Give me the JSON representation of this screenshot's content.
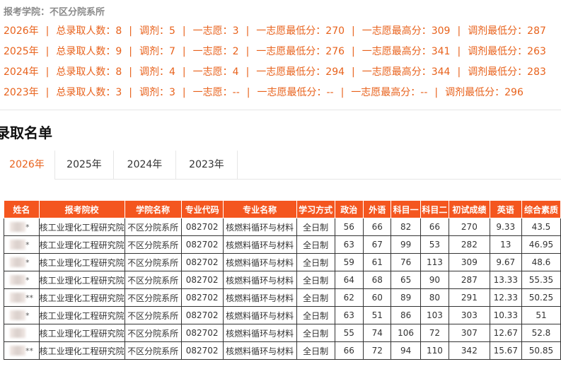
{
  "college": {
    "label": "报考学院：",
    "value": "不区分院系所"
  },
  "stats_separator": "|",
  "stats": [
    {
      "year": "2026年",
      "total": "总录取人数：8",
      "adjust": "调剂：5",
      "first_choice": "一志愿：3",
      "first_min": "一志愿最低分：270",
      "first_max": "一志愿最高分：309",
      "adjust_min": "调剂最低分：287"
    },
    {
      "year": "2025年",
      "total": "总录取人数：9",
      "adjust": "调剂：7",
      "first_choice": "一志愿：2",
      "first_min": "一志愿最低分：276",
      "first_max": "一志愿最高分：341",
      "adjust_min": "调剂最低分：263"
    },
    {
      "year": "2024年",
      "total": "总录取人数：8",
      "adjust": "调剂：4",
      "first_choice": "一志愿：4",
      "first_min": "一志愿最低分：294",
      "first_max": "一志愿最高分：344",
      "adjust_min": "调剂最低分：283"
    },
    {
      "year": "2023年",
      "total": "总录取人数：3",
      "adjust": "调剂：3",
      "first_choice": "一志愿：--",
      "first_min": "一志愿最低分：--",
      "first_max": "一志愿最高分：--",
      "adjust_min": "调剂最低分：296"
    }
  ],
  "section_title": "录取名单",
  "tabs": [
    {
      "label": "2026年",
      "active": true
    },
    {
      "label": "2025年",
      "active": false
    },
    {
      "label": "2024年",
      "active": false
    },
    {
      "label": "2023年",
      "active": false
    }
  ],
  "table": {
    "headers": [
      "姓名",
      "报考院校",
      "学院名称",
      "专业代码",
      "专业名称",
      "学习方式",
      "政治",
      "外语",
      "科目一",
      "科目二",
      "初试成绩",
      "英语",
      "综合素质"
    ],
    "rows": [
      [
        "*",
        "核工业理化工程研究院",
        "不区分院系所",
        "082702",
        "核燃料循环与材料",
        "全日制",
        "56",
        "66",
        "82",
        "66",
        "270",
        "9.33",
        "43.5"
      ],
      [
        "*",
        "核工业理化工程研究院",
        "不区分院系所",
        "082702",
        "核燃料循环与材料",
        "全日制",
        "63",
        "67",
        "99",
        "53",
        "282",
        "13",
        "46.95"
      ],
      [
        "*",
        "核工业理化工程研究院",
        "不区分院系所",
        "082702",
        "核燃料循环与材料",
        "全日制",
        "59",
        "61",
        "76",
        "113",
        "309",
        "9.67",
        "48.6"
      ],
      [
        "*",
        "核工业理化工程研究院",
        "不区分院系所",
        "082702",
        "核燃料循环与材料",
        "全日制",
        "64",
        "68",
        "65",
        "90",
        "287",
        "13.33",
        "55.35"
      ],
      [
        "**",
        "核工业理化工程研究院",
        "不区分院系所",
        "082702",
        "核燃料循环与材料",
        "全日制",
        "62",
        "60",
        "89",
        "80",
        "291",
        "12.33",
        "50.25"
      ],
      [
        "*",
        "核工业理化工程研究院",
        "不区分院系所",
        "082702",
        "核燃料循环与材料",
        "全日制",
        "63",
        "51",
        "86",
        "103",
        "303",
        "10.33",
        "51"
      ],
      [
        "",
        "核工业理化工程研究院",
        "不区分院系所",
        "082702",
        "核燃料循环与材料",
        "全日制",
        "55",
        "74",
        "106",
        "72",
        "307",
        "12.67",
        "52.8"
      ],
      [
        "**",
        "核工业理化工程研究院",
        "不区分院系所",
        "082702",
        "核燃料循环与材料",
        "全日制",
        "66",
        "72",
        "94",
        "110",
        "342",
        "15.67",
        "50.85"
      ]
    ]
  },
  "colors": {
    "accent": "#e8621c",
    "header_bg": "#f4561f"
  }
}
